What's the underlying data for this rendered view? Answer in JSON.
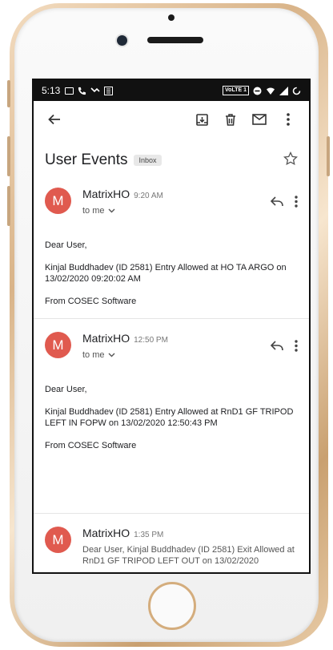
{
  "status": {
    "time": "5:13",
    "volte": "VoLTE 1"
  },
  "subject": "User Events",
  "label": "Inbox",
  "messages": [
    {
      "avatar": "M",
      "sender": "MatrixHO",
      "time": "9:20 AM",
      "to": "to me",
      "greeting": "Dear User,",
      "body": "Kinjal Buddhadev (ID 2581) Entry Allowed at HO TA ARGO on 13/02/2020 09:20:02 AM",
      "signature": "From COSEC Software"
    },
    {
      "avatar": "M",
      "sender": "MatrixHO",
      "time": "12:50 PM",
      "to": "to me",
      "greeting": "Dear User,",
      "body": "Kinjal Buddhadev (ID 2581) Entry Allowed at RnD1 GF TRIPOD LEFT IN FOPW on 13/02/2020 12:50:43 PM",
      "signature": "From COSEC Software"
    },
    {
      "avatar": "M",
      "sender": "MatrixHO",
      "time": "1:35 PM",
      "preview": "Dear User, Kinjal Buddhadev (ID 2581) Exit Allowed at RnD1 GF TRIPOD LEFT OUT on 13/02/2020"
    }
  ],
  "colors": {
    "avatar": "#e05a4f",
    "statusbar": "#111111"
  }
}
